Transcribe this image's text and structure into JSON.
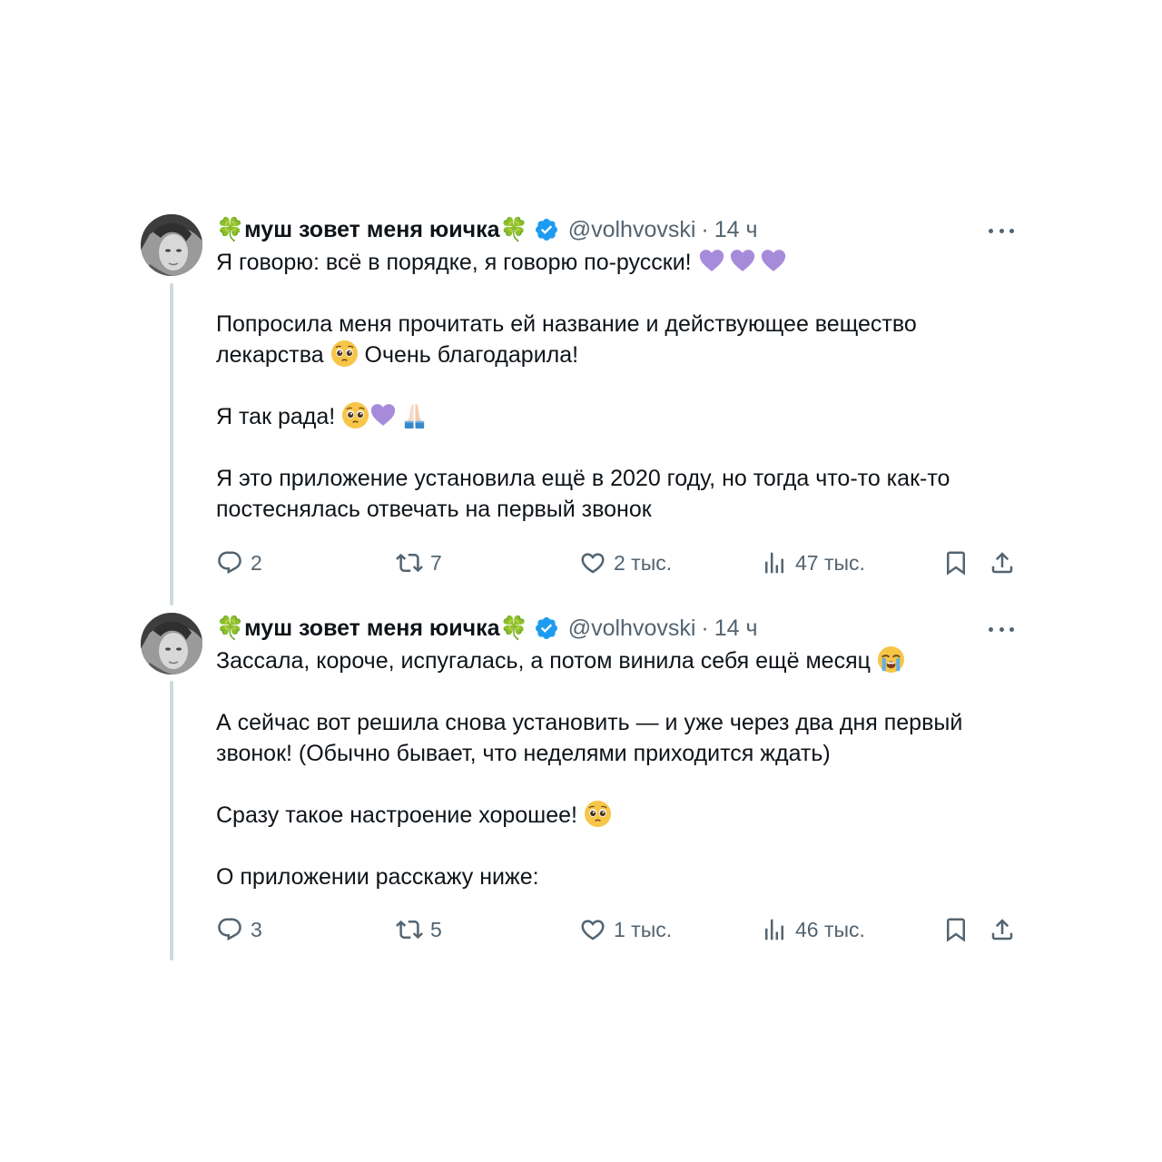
{
  "tweets": [
    {
      "display_name": "муш зовет меня юичка",
      "handle": "@volhvovski",
      "dot": "·",
      "time": "14 ч",
      "paragraphs": [
        "Я говорю: всё в порядке, я говорю по-русски! ",
        "Попросила меня прочитать ей название и действующее вещество лекарства ",
        " Очень благодарила!",
        "Я так рада! ",
        "Я это приложение установила ещё в 2020 году, но тогда что-то как-то постеснялась отвечать на первый звонок"
      ],
      "stats": {
        "replies": "2",
        "reposts": "7",
        "likes": "2 тыс.",
        "views": "47 тыс."
      }
    },
    {
      "display_name": "муш зовет меня юичка",
      "handle": "@volhvovski",
      "dot": "·",
      "time": "14 ч",
      "paragraphs": [
        "Зассала, короче, испугалась, а потом винила себя ещё месяц ",
        "А сейчас вот решила снова установить — и уже через два дня первый звонок! (Обычно бывает, что неделями приходится ждать)",
        "Сразу такое настроение хорошее! ",
        "О приложении расскажу ниже:"
      ],
      "stats": {
        "replies": "3",
        "reposts": "5",
        "likes": "1 тыс.",
        "views": "46 тыс."
      }
    }
  ],
  "icons": {
    "clover": "four-leaf-clover-icon",
    "verified": "verified-badge-icon",
    "reply": "reply-icon",
    "repost": "repost-icon",
    "like": "heart-icon",
    "views": "views-chart-icon",
    "bookmark": "bookmark-icon",
    "share": "share-icon",
    "more": "more-icon"
  },
  "colors": {
    "text": "#0f1419",
    "muted": "#536471",
    "verified": "#1d9bf0",
    "thread_line": "#cfd9de",
    "purple_heart": "#a78bdb",
    "clover": "#3aa63a"
  }
}
